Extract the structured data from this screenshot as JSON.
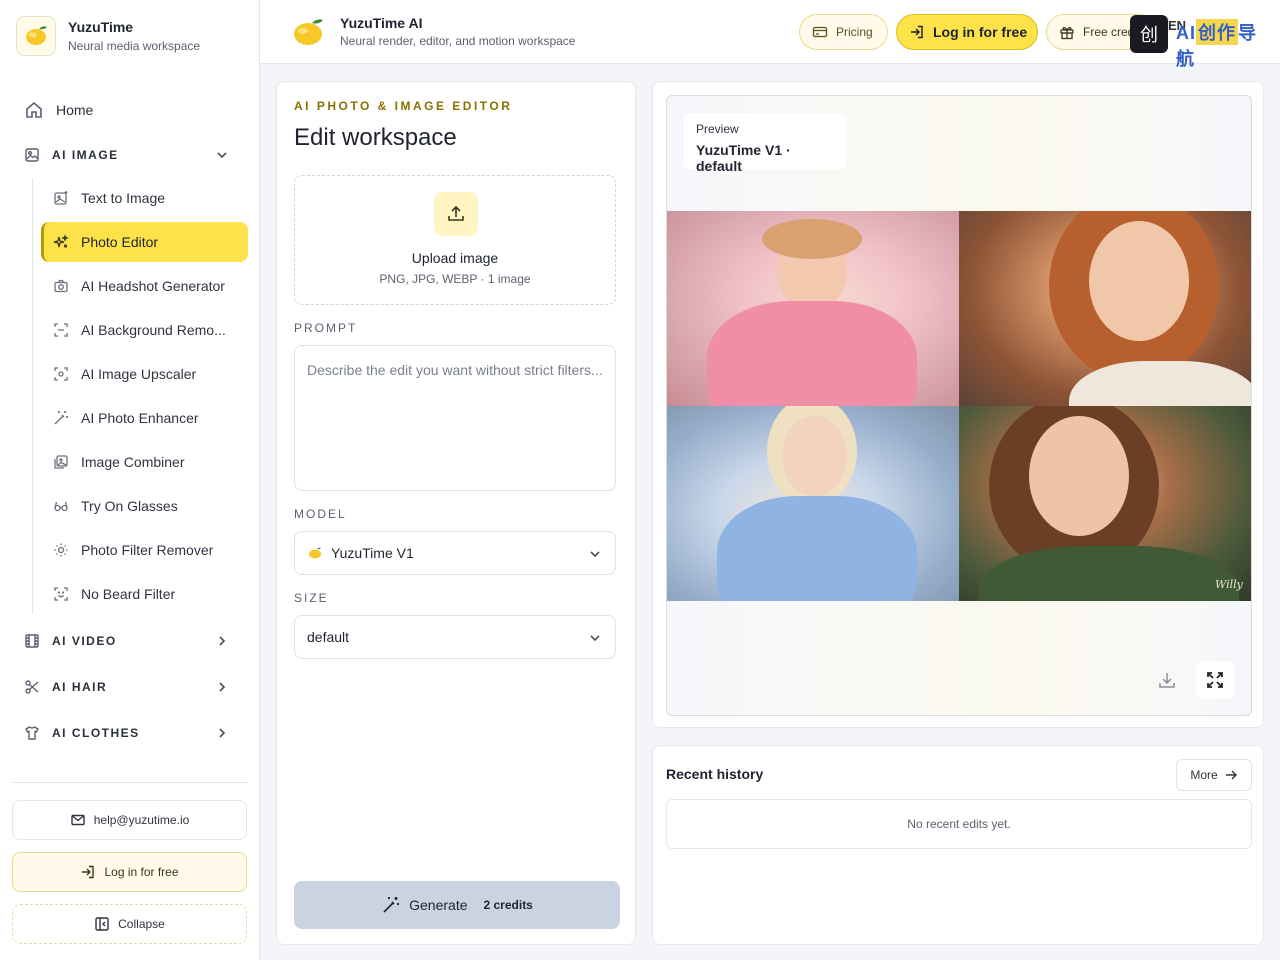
{
  "brand": {
    "name": "YuzuTime",
    "tagline": "Neural media workspace"
  },
  "header": {
    "title": "YuzuTime AI",
    "subtitle": "Neural render, editor, and motion workspace",
    "pricing_label": "Pricing",
    "login_label": "Log in for free",
    "credits_label": "Free credits",
    "lang_label": "EN"
  },
  "watermark": {
    "box_glyph": "创",
    "text_a": "AI",
    "text_b": "创作",
    "text_c": "导航"
  },
  "sidebar": {
    "home": "Home",
    "sections": {
      "image": "AI IMAGE",
      "video": "AI VIDEO",
      "hair": "AI HAIR",
      "clothes": "AI CLOTHES"
    },
    "image_items": [
      {
        "label": "Text to Image",
        "icon": "image-sparkle-icon"
      },
      {
        "label": "Photo Editor",
        "icon": "sparkles-icon",
        "active": true
      },
      {
        "label": "AI Headshot Generator",
        "icon": "camera-icon"
      },
      {
        "label": "AI Background Remo...",
        "icon": "scan-icon"
      },
      {
        "label": "AI Image Upscaler",
        "icon": "scan-focus-icon"
      },
      {
        "label": "AI Photo Enhancer",
        "icon": "magic-wand-icon"
      },
      {
        "label": "Image Combiner",
        "icon": "images-icon"
      },
      {
        "label": "Try On Glasses",
        "icon": "glasses-icon"
      },
      {
        "label": "Photo Filter Remover",
        "icon": "sun-icon"
      },
      {
        "label": "No Beard Filter",
        "icon": "face-scan-icon"
      }
    ],
    "email": "help@yuzutime.io",
    "login_label": "Log in for free",
    "collapse_label": "Collapse"
  },
  "editor": {
    "eyebrow": "AI PHOTO & IMAGE EDITOR",
    "title": "Edit workspace",
    "upload_title": "Upload image",
    "upload_hint": "PNG, JPG, WEBP · 1 image",
    "prompt_label": "PROMPT",
    "prompt_placeholder": "Describe the edit you want without strict filters...",
    "prompt_value": "",
    "model_label": "MODEL",
    "model_value": "YuzuTime V1",
    "size_label": "SIZE",
    "size_value": "default",
    "generate_label": "Generate",
    "generate_credits": "2 credits"
  },
  "preview": {
    "chip_label": "Preview",
    "chip_value": "YuzuTime V1 · default",
    "signature": "Willy"
  },
  "history": {
    "title": "Recent history",
    "more_label": "More",
    "empty_text": "No recent edits yet."
  },
  "colors": {
    "accent": "#fde24a",
    "accent_dark": "#8a7200",
    "generate_bg": "#c9d3e1"
  }
}
